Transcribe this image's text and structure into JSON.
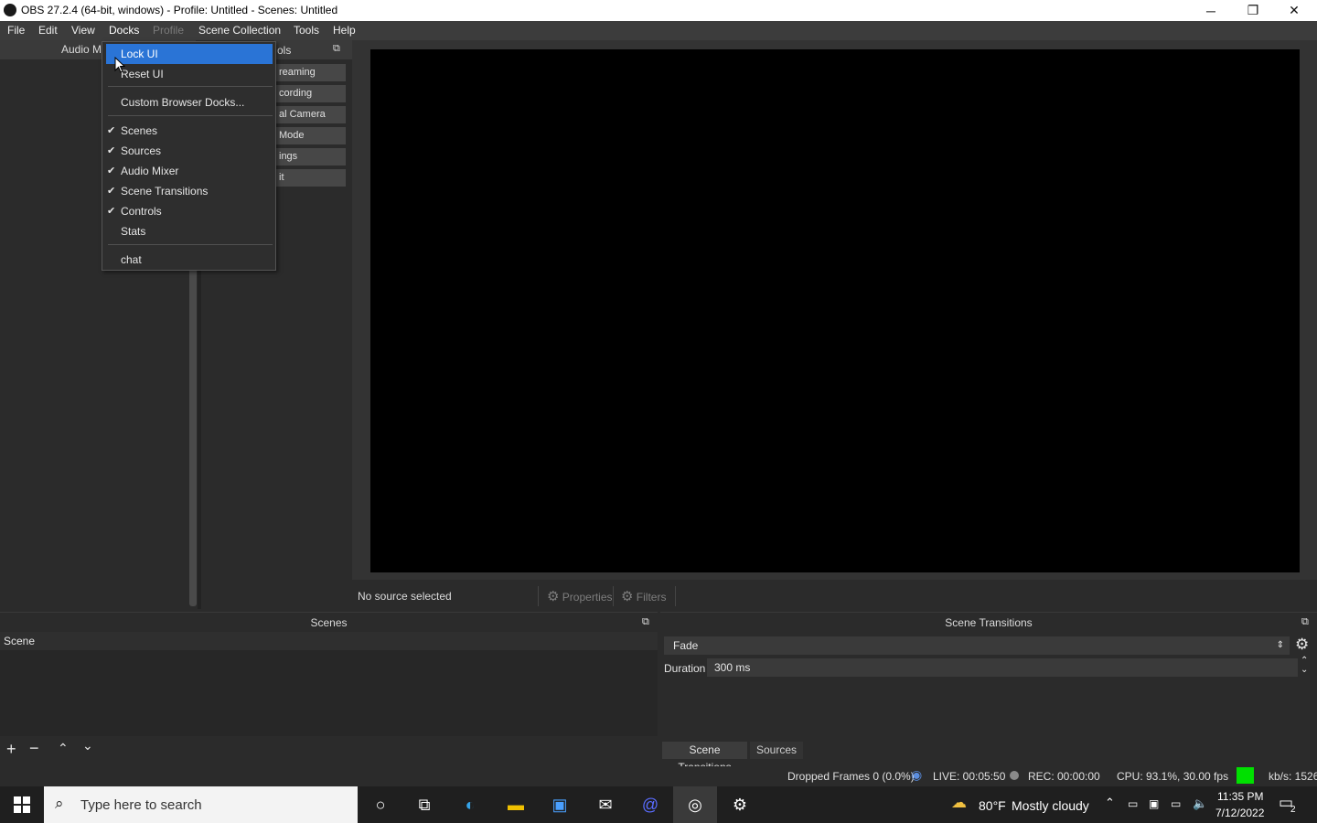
{
  "window": {
    "title": "OBS 27.2.4 (64-bit, windows) - Profile: Untitled - Scenes: Untitled",
    "minimize": "─",
    "restore": "❐",
    "close": "✕"
  },
  "menu": [
    "File",
    "Edit",
    "View",
    "Docks",
    "Profile",
    "Scene Collection",
    "Tools",
    "Help"
  ],
  "left_dock": {
    "audio_header": "Audio M",
    "controls_header": "ols",
    "controls": [
      "reaming",
      "cording",
      "al Camera",
      "Mode",
      "ings",
      "it"
    ]
  },
  "dropdown": {
    "items": [
      {
        "label": "Lock UI",
        "checked": false
      },
      {
        "label": "Reset UI",
        "checked": false
      },
      {
        "label": "Custom Browser Docks...",
        "checked": false
      },
      {
        "label": "Scenes",
        "checked": true
      },
      {
        "label": "Sources",
        "checked": true
      },
      {
        "label": "Audio Mixer",
        "checked": true
      },
      {
        "label": "Scene Transitions",
        "checked": true
      },
      {
        "label": "Controls",
        "checked": true
      },
      {
        "label": "Stats",
        "checked": false
      },
      {
        "label": "chat",
        "checked": false
      }
    ],
    "check_glyph": "✔"
  },
  "source_bar": {
    "status": "No source selected",
    "properties": "Properties",
    "filters": "Filters"
  },
  "scenes_panel": {
    "title": "Scenes",
    "items": [
      "Scene"
    ]
  },
  "transitions_panel": {
    "title": "Scene Transitions",
    "transition": "Fade",
    "duration_label": "Duration",
    "duration_value": "300 ms",
    "tabs": [
      "Scene Transitions",
      "Sources"
    ]
  },
  "status": {
    "dropped": "Dropped Frames 0 (0.0%)",
    "live": "LIVE: 00:05:50",
    "rec": "REC: 00:00:00",
    "cpu": "CPU: 93.1%, 30.00 fps",
    "kbs": "kb/s: 1526",
    "indicator_color": "#00e000"
  },
  "taskbar": {
    "search_placeholder": "Type here to search",
    "weather_temp": "80°F",
    "weather_text": "Mostly cloudy",
    "time": "11:35 PM",
    "date": "7/12/2022",
    "notifications": "2"
  }
}
